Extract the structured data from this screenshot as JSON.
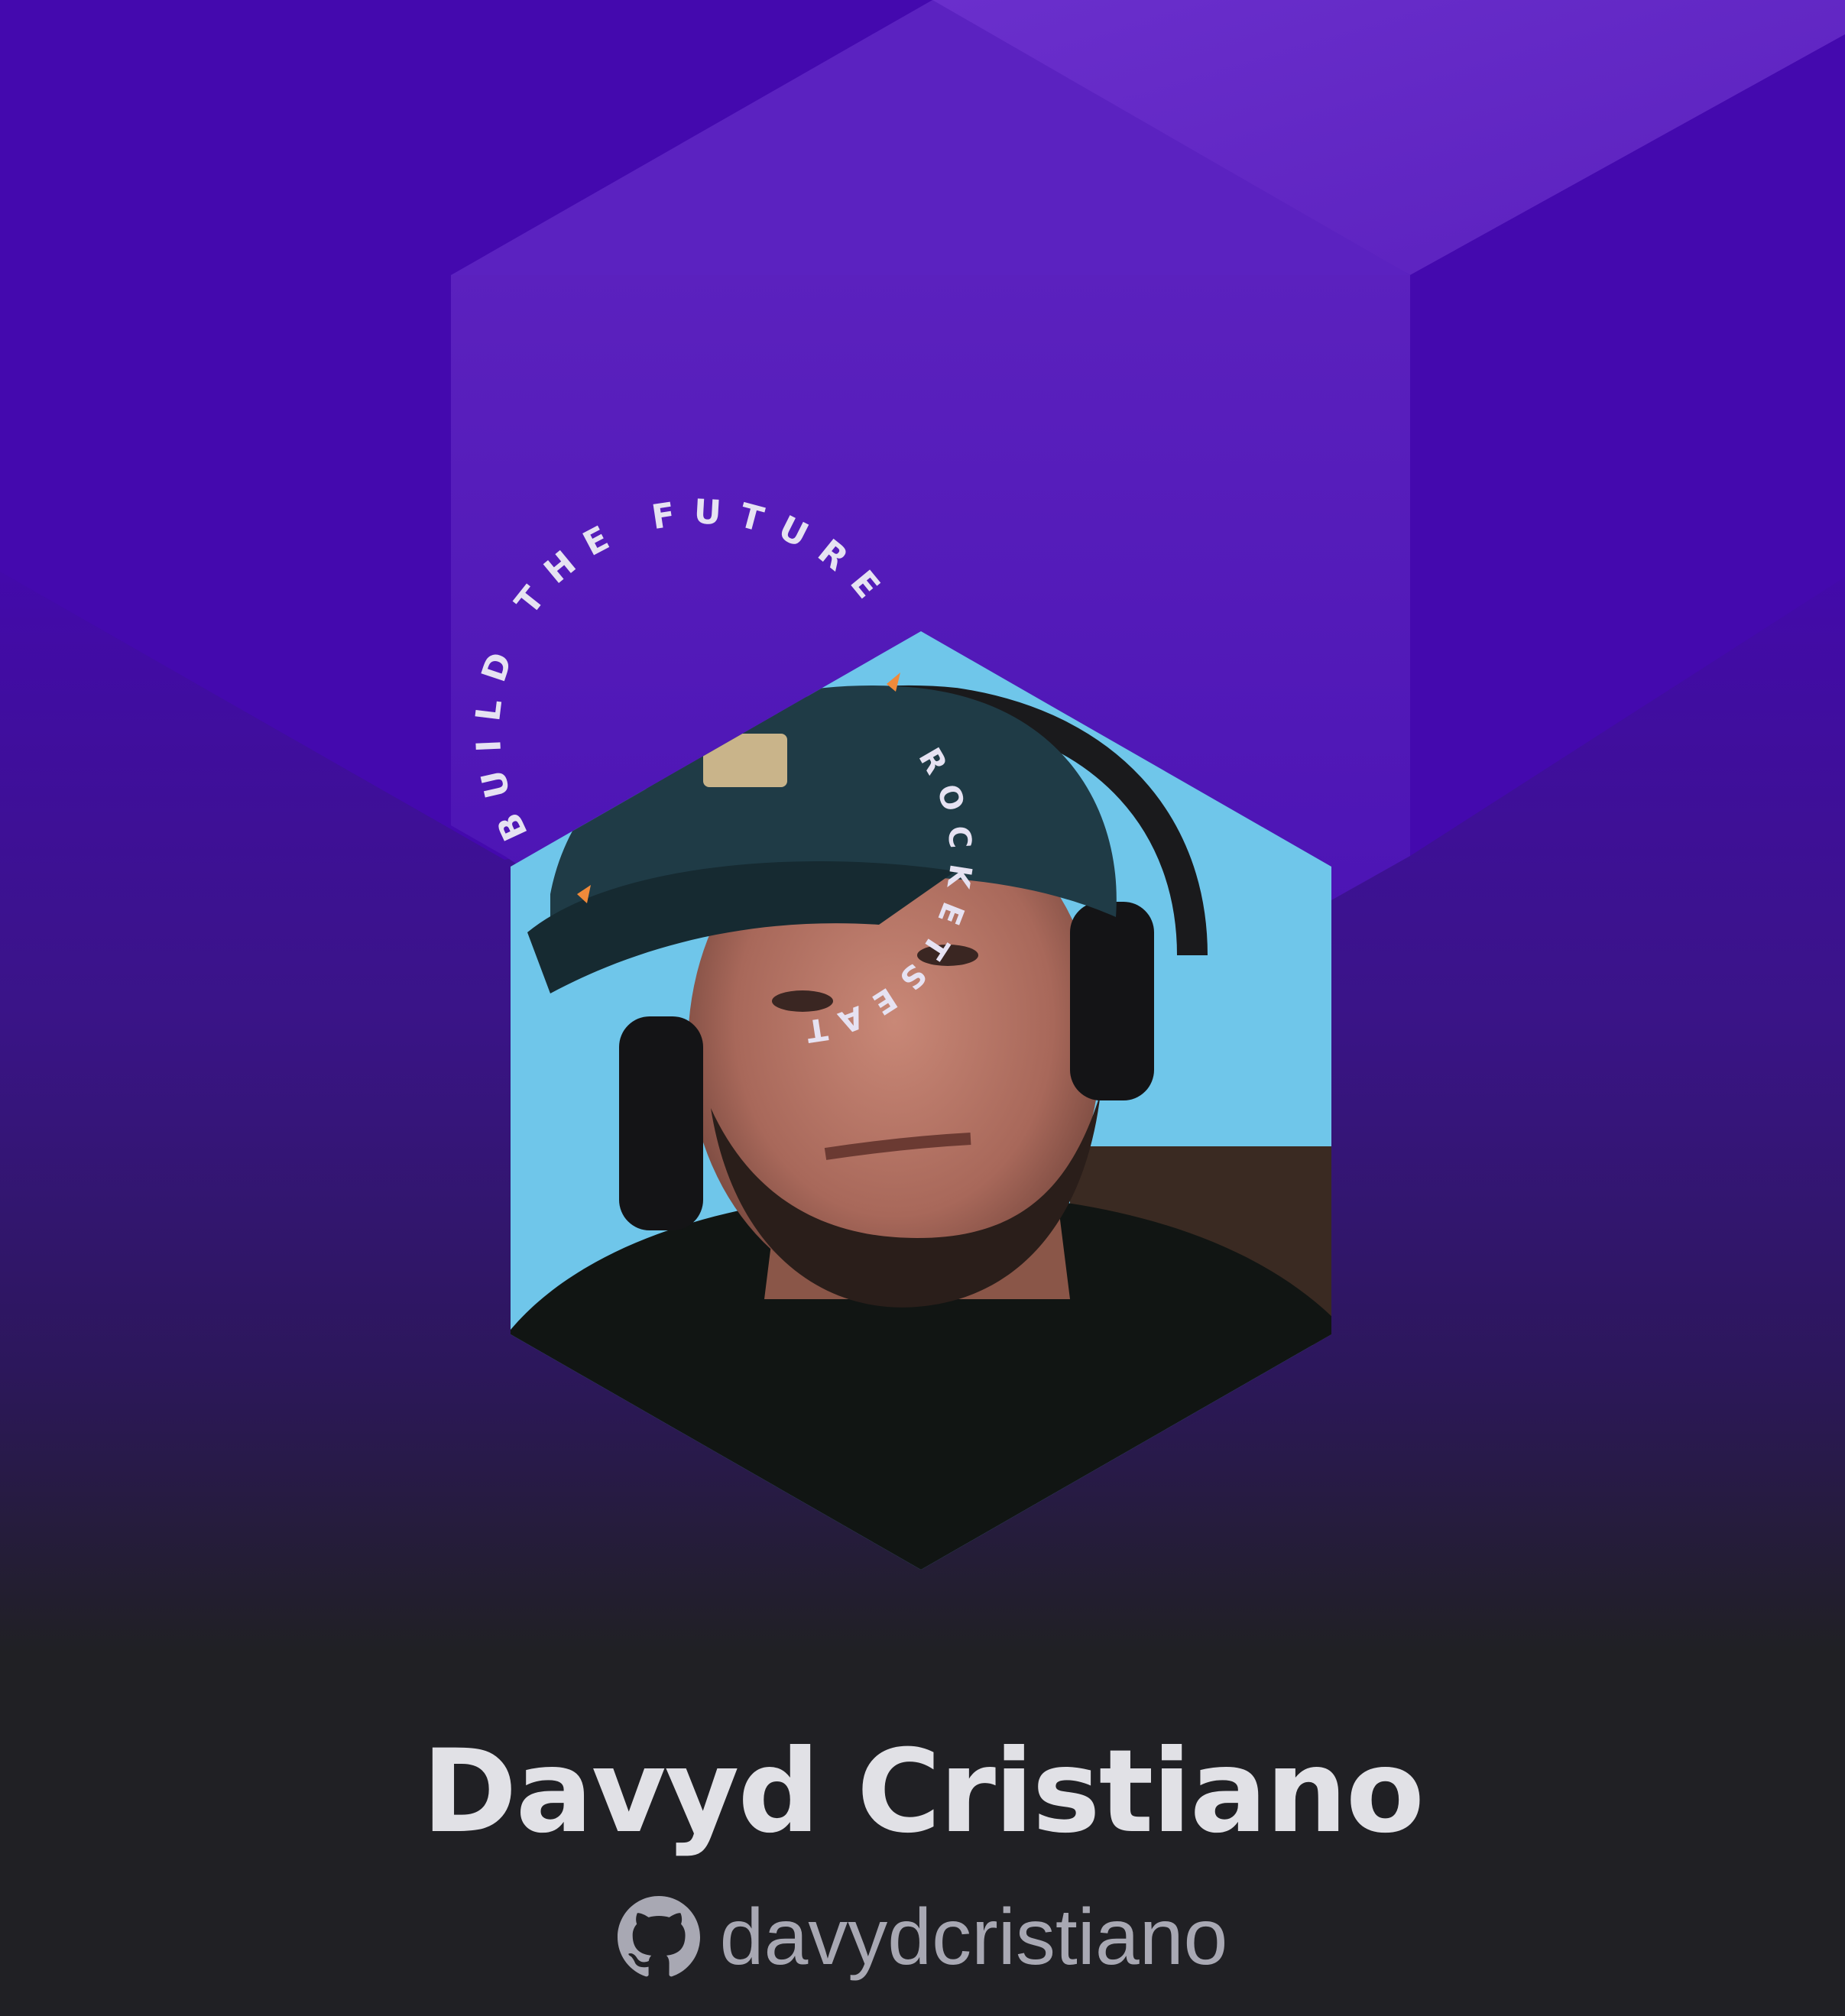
{
  "badge": {
    "ring_text_top": "BUILD THE FUTURE",
    "ring_text_bottom": "ROCKETSEAT",
    "colors": {
      "purple_dark": "#4409ae",
      "purple_light": "#6128c3",
      "gradient_mid": "#2e1460",
      "card_bg": "#202024",
      "name_text": "#e1e1e6",
      "handle_text": "#a8a8b3"
    }
  },
  "profile": {
    "name": "Davyd Cristiano",
    "github_handle": "davydcristiano",
    "icon": "github-icon",
    "avatar_description_icon": "profile-photo"
  }
}
